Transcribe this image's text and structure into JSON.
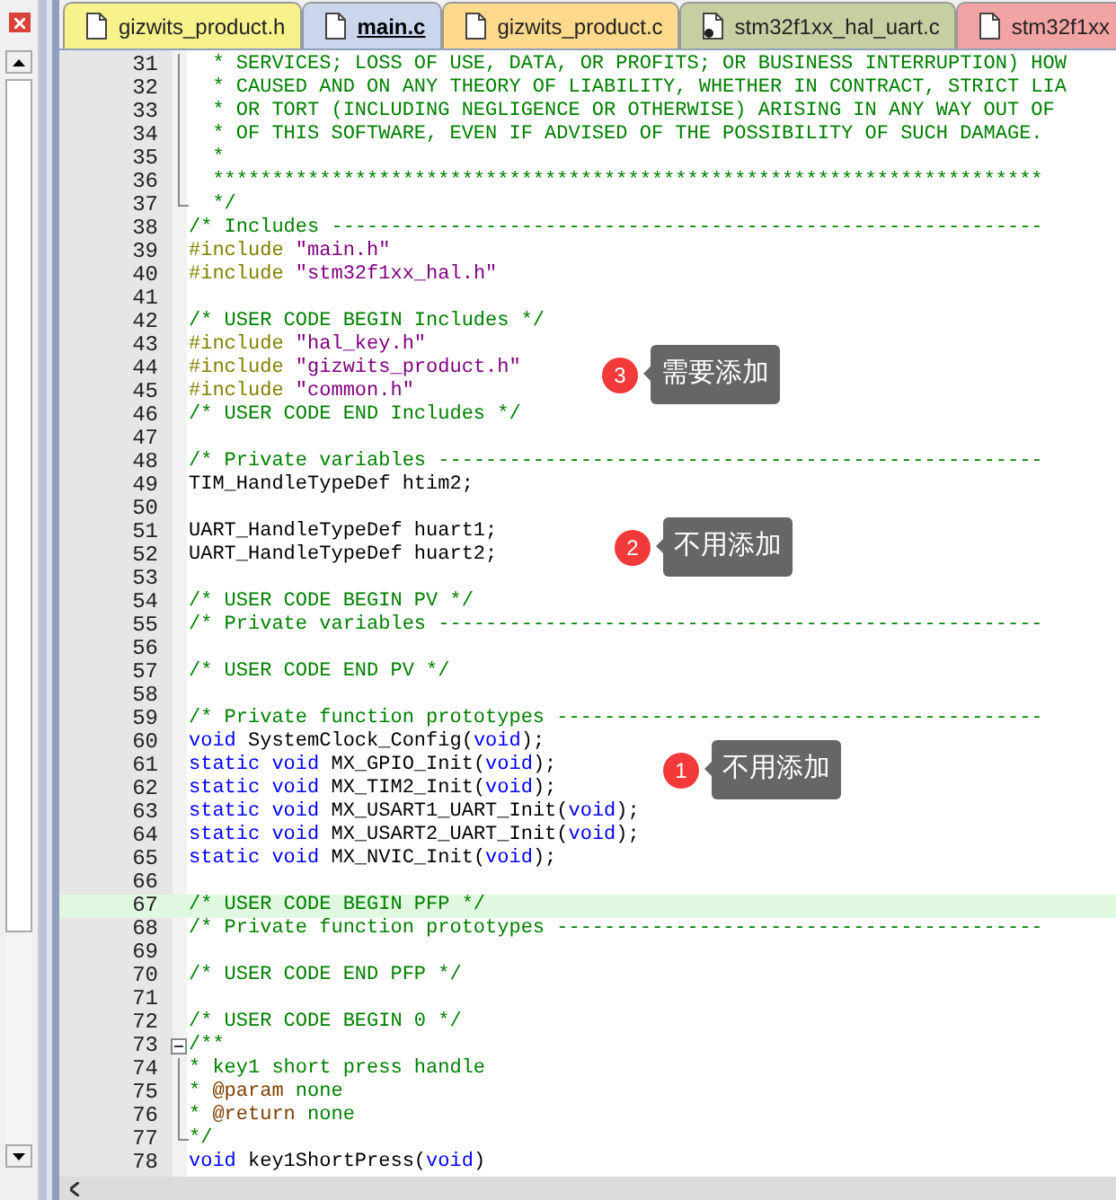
{
  "tabs": [
    {
      "label": "gizwits_product.h",
      "selected": false,
      "color": "#f7f28c",
      "kind": "document"
    },
    {
      "label": "main.c",
      "selected": true,
      "color": "#c9d6ec",
      "kind": "document"
    },
    {
      "label": "gizwits_product.c",
      "selected": false,
      "color": "#ffd98c",
      "kind": "document"
    },
    {
      "label": "stm32f1xx_hal_uart.c",
      "selected": false,
      "color": "#c6cfa2",
      "kind": "marked"
    },
    {
      "label": "stm32f1xx",
      "selected": false,
      "color": "#f2a4a4",
      "kind": "document"
    }
  ],
  "lines": [
    {
      "no": "31",
      "highlighted": false,
      "kind": "foldbody",
      "segs": [
        {
          "kind": "comment",
          "t": "  * SERVICES; LOSS OF USE, DATA, OR PROFITS; OR BUSINESS INTERRUPTION) HOW"
        }
      ]
    },
    {
      "no": "32",
      "highlighted": false,
      "kind": "foldbody",
      "segs": [
        {
          "kind": "comment",
          "t": "  * CAUSED AND ON ANY THEORY OF LIABILITY, WHETHER IN CONTRACT, STRICT LIA"
        }
      ]
    },
    {
      "no": "33",
      "highlighted": false,
      "kind": "foldbody",
      "segs": [
        {
          "kind": "comment",
          "t": "  * OR TORT (INCLUDING NEGLIGENCE OR OTHERWISE) ARISING IN ANY WAY OUT OF"
        }
      ]
    },
    {
      "no": "34",
      "highlighted": false,
      "kind": "foldbody",
      "segs": [
        {
          "kind": "comment",
          "t": "  * OF THIS SOFTWARE, EVEN IF ADVISED OF THE POSSIBILITY OF SUCH DAMAGE."
        }
      ]
    },
    {
      "no": "35",
      "highlighted": false,
      "kind": "foldbody",
      "segs": [
        {
          "kind": "comment",
          "t": "  *"
        }
      ]
    },
    {
      "no": "36",
      "highlighted": false,
      "kind": "foldbody",
      "segs": [
        {
          "kind": "comment",
          "t": "  **********************************************************************"
        }
      ]
    },
    {
      "no": "37",
      "highlighted": false,
      "kind": "foldend",
      "segs": [
        {
          "kind": "comment",
          "t": "  */"
        }
      ]
    },
    {
      "no": "38",
      "highlighted": false,
      "kind": "plain",
      "segs": [
        {
          "kind": "comment",
          "t": "/* Includes ------------------------------------------------------------"
        }
      ]
    },
    {
      "no": "39",
      "highlighted": false,
      "kind": "plain",
      "segs": [
        {
          "kind": "preprocessor",
          "t": "#include "
        },
        {
          "kind": "string",
          "t": "\"main.h\""
        }
      ]
    },
    {
      "no": "40",
      "highlighted": false,
      "kind": "plain",
      "segs": [
        {
          "kind": "preprocessor",
          "t": "#include "
        },
        {
          "kind": "string",
          "t": "\"stm32f1xx_hal.h\""
        }
      ]
    },
    {
      "no": "41",
      "highlighted": false,
      "kind": "plain"
    },
    {
      "no": "42",
      "highlighted": false,
      "kind": "plain",
      "segs": [
        {
          "kind": "comment",
          "t": "/* USER CODE BEGIN Includes */"
        }
      ]
    },
    {
      "no": "43",
      "highlighted": false,
      "kind": "plain",
      "segs": [
        {
          "kind": "preprocessor",
          "t": "#include "
        },
        {
          "kind": "string",
          "t": "\"hal_key.h\""
        }
      ]
    },
    {
      "no": "44",
      "highlighted": false,
      "kind": "plain",
      "segs": [
        {
          "kind": "preprocessor",
          "t": "#include "
        },
        {
          "kind": "string",
          "t": "\"gizwits_product.h\""
        }
      ]
    },
    {
      "no": "45",
      "highlighted": false,
      "kind": "plain",
      "segs": [
        {
          "kind": "preprocessor",
          "t": "#include "
        },
        {
          "kind": "string",
          "t": "\"common.h\""
        }
      ]
    },
    {
      "no": "46",
      "highlighted": false,
      "kind": "plain",
      "segs": [
        {
          "kind": "comment",
          "t": "/* USER CODE END Includes */"
        }
      ]
    },
    {
      "no": "47",
      "highlighted": false,
      "kind": "plain"
    },
    {
      "no": "48",
      "highlighted": false,
      "kind": "plain",
      "segs": [
        {
          "kind": "comment",
          "t": "/* Private variables ---------------------------------------------------"
        }
      ]
    },
    {
      "no": "49",
      "highlighted": false,
      "kind": "plain",
      "segs": [
        {
          "kind": "plain",
          "t": "TIM_HandleTypeDef htim2;"
        }
      ]
    },
    {
      "no": "50",
      "highlighted": false,
      "kind": "plain"
    },
    {
      "no": "51",
      "highlighted": false,
      "kind": "plain",
      "segs": [
        {
          "kind": "plain",
          "t": "UART_HandleTypeDef huart1;"
        }
      ]
    },
    {
      "no": "52",
      "highlighted": false,
      "kind": "plain",
      "segs": [
        {
          "kind": "plain",
          "t": "UART_HandleTypeDef huart2;"
        }
      ]
    },
    {
      "no": "53",
      "highlighted": false,
      "kind": "plain"
    },
    {
      "no": "54",
      "highlighted": false,
      "kind": "plain",
      "segs": [
        {
          "kind": "comment",
          "t": "/* USER CODE BEGIN PV */"
        }
      ]
    },
    {
      "no": "55",
      "highlighted": false,
      "kind": "plain",
      "segs": [
        {
          "kind": "comment",
          "t": "/* Private variables ---------------------------------------------------"
        }
      ]
    },
    {
      "no": "56",
      "highlighted": false,
      "kind": "plain"
    },
    {
      "no": "57",
      "highlighted": false,
      "kind": "plain",
      "segs": [
        {
          "kind": "comment",
          "t": "/* USER CODE END PV */"
        }
      ]
    },
    {
      "no": "58",
      "highlighted": false,
      "kind": "plain"
    },
    {
      "no": "59",
      "highlighted": false,
      "kind": "plain",
      "segs": [
        {
          "kind": "comment",
          "t": "/* Private function prototypes -----------------------------------------"
        }
      ]
    },
    {
      "no": "60",
      "highlighted": false,
      "kind": "plain",
      "segs": [
        {
          "kind": "keyword",
          "t": "void"
        },
        {
          "kind": "plain",
          "t": " SystemClock_Config("
        },
        {
          "kind": "keyword",
          "t": "void"
        },
        {
          "kind": "plain",
          "t": ");"
        }
      ]
    },
    {
      "no": "61",
      "highlighted": false,
      "kind": "plain",
      "segs": [
        {
          "kind": "keyword",
          "t": "static void"
        },
        {
          "kind": "plain",
          "t": " MX_GPIO_Init("
        },
        {
          "kind": "keyword",
          "t": "void"
        },
        {
          "kind": "plain",
          "t": ");"
        }
      ]
    },
    {
      "no": "62",
      "highlighted": false,
      "kind": "plain",
      "segs": [
        {
          "kind": "keyword",
          "t": "static void"
        },
        {
          "kind": "plain",
          "t": " MX_TIM2_Init("
        },
        {
          "kind": "keyword",
          "t": "void"
        },
        {
          "kind": "plain",
          "t": ");"
        }
      ]
    },
    {
      "no": "63",
      "highlighted": false,
      "kind": "plain",
      "segs": [
        {
          "kind": "keyword",
          "t": "static void"
        },
        {
          "kind": "plain",
          "t": " MX_USART1_UART_Init("
        },
        {
          "kind": "keyword",
          "t": "void"
        },
        {
          "kind": "plain",
          "t": ");"
        }
      ]
    },
    {
      "no": "64",
      "highlighted": false,
      "kind": "plain",
      "segs": [
        {
          "kind": "keyword",
          "t": "static void"
        },
        {
          "kind": "plain",
          "t": " MX_USART2_UART_Init("
        },
        {
          "kind": "keyword",
          "t": "void"
        },
        {
          "kind": "plain",
          "t": ");"
        }
      ]
    },
    {
      "no": "65",
      "highlighted": false,
      "kind": "plain",
      "segs": [
        {
          "kind": "keyword",
          "t": "static void"
        },
        {
          "kind": "plain",
          "t": " MX_NVIC_Init("
        },
        {
          "kind": "keyword",
          "t": "void"
        },
        {
          "kind": "plain",
          "t": ");"
        }
      ]
    },
    {
      "no": "66",
      "highlighted": false,
      "kind": "plain"
    },
    {
      "no": "67",
      "highlighted": true,
      "kind": "plain",
      "segs": [
        {
          "kind": "comment",
          "t": "/* USER CODE BEGIN PFP */"
        }
      ]
    },
    {
      "no": "68",
      "highlighted": false,
      "kind": "plain",
      "segs": [
        {
          "kind": "comment",
          "t": "/* Private function prototypes -----------------------------------------"
        }
      ]
    },
    {
      "no": "69",
      "highlighted": false,
      "kind": "plain"
    },
    {
      "no": "70",
      "highlighted": false,
      "kind": "plain",
      "segs": [
        {
          "kind": "comment",
          "t": "/* USER CODE END PFP */"
        }
      ]
    },
    {
      "no": "71",
      "highlighted": false,
      "kind": "plain"
    },
    {
      "no": "72",
      "highlighted": false,
      "kind": "plain",
      "segs": [
        {
          "kind": "comment",
          "t": "/* USER CODE BEGIN 0 */"
        }
      ]
    },
    {
      "no": "73",
      "highlighted": false,
      "kind": "foldstart",
      "segs": [
        {
          "kind": "comment",
          "t": "/**"
        }
      ]
    },
    {
      "no": "74",
      "highlighted": false,
      "kind": "foldbody",
      "segs": [
        {
          "kind": "comment",
          "t": "* key1 short press handle"
        }
      ]
    },
    {
      "no": "75",
      "highlighted": false,
      "kind": "foldbody",
      "segs": [
        {
          "kind": "comment",
          "t": "* "
        },
        {
          "kind": "doctag",
          "t": "@param"
        },
        {
          "kind": "comment",
          "t": " none"
        }
      ]
    },
    {
      "no": "76",
      "highlighted": false,
      "kind": "foldbody",
      "segs": [
        {
          "kind": "comment",
          "t": "* "
        },
        {
          "kind": "doctag",
          "t": "@return"
        },
        {
          "kind": "comment",
          "t": " none"
        }
      ]
    },
    {
      "no": "77",
      "highlighted": false,
      "kind": "foldend",
      "segs": [
        {
          "kind": "comment",
          "t": "*/"
        }
      ]
    },
    {
      "no": "78",
      "highlighted": false,
      "kind": "plain",
      "segs": [
        {
          "kind": "keyword",
          "t": "void"
        },
        {
          "kind": "plain",
          "t": " key1ShortPress("
        },
        {
          "kind": "keyword",
          "t": "void"
        },
        {
          "kind": "plain",
          "t": ")"
        }
      ]
    }
  ],
  "callouts": [
    {
      "number": "3",
      "text": "需要添加"
    },
    {
      "number": "2",
      "text": "不用添加"
    },
    {
      "number": "1",
      "text": "不用添加"
    }
  ]
}
